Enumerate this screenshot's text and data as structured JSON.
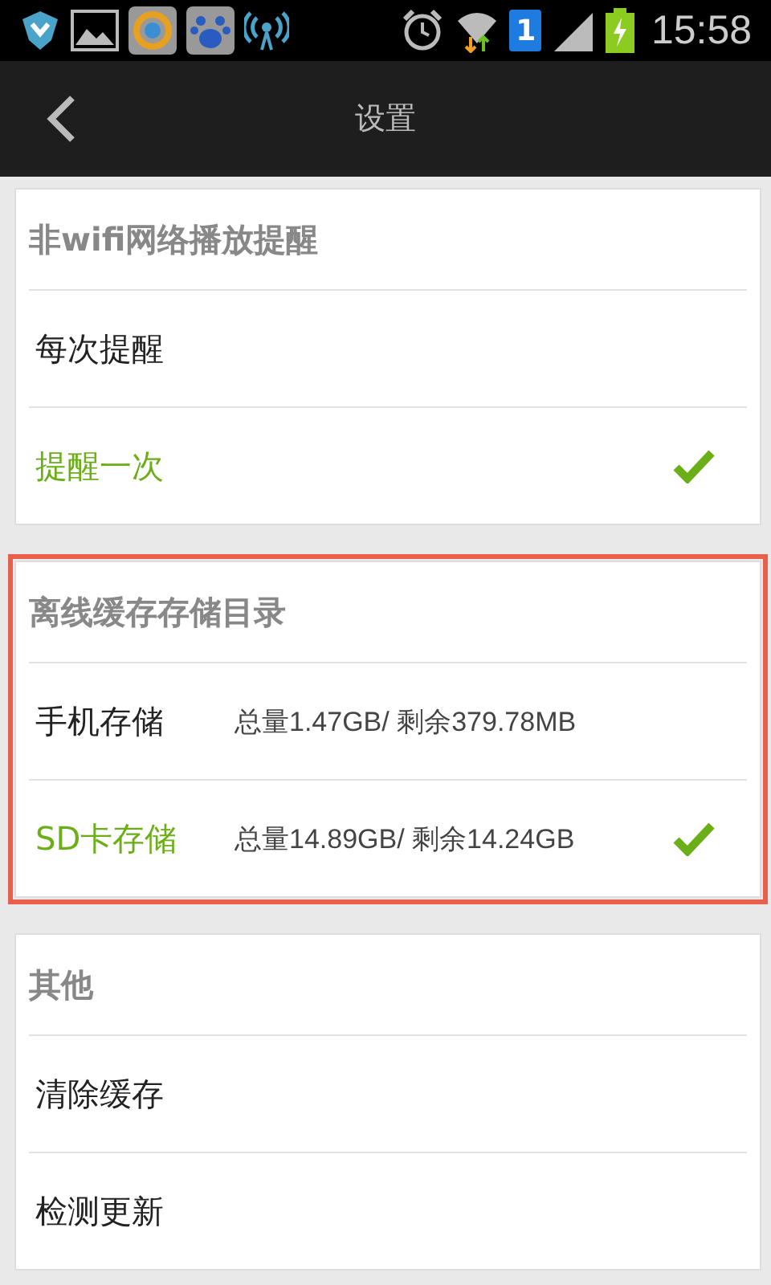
{
  "status_bar": {
    "time": "15:58",
    "sim_number": "1"
  },
  "header": {
    "title": "设置"
  },
  "sections": [
    {
      "title": "非wifi网络播放提醒",
      "highlighted": false,
      "items": [
        {
          "label": "每次提醒",
          "selected": false
        },
        {
          "label": "提醒一次",
          "selected": true
        }
      ]
    },
    {
      "title": "离线缓存存储目录",
      "highlighted": true,
      "items": [
        {
          "label": "手机存储",
          "detail": "总量1.47GB/ 剩余379.78MB",
          "selected": false
        },
        {
          "label": "SD卡存储",
          "detail": "总量14.89GB/ 剩余14.24GB",
          "selected": true
        }
      ]
    },
    {
      "title": "其他",
      "highlighted": false,
      "items": [
        {
          "label": "清除缓存"
        },
        {
          "label": "检测更新"
        }
      ]
    }
  ]
}
